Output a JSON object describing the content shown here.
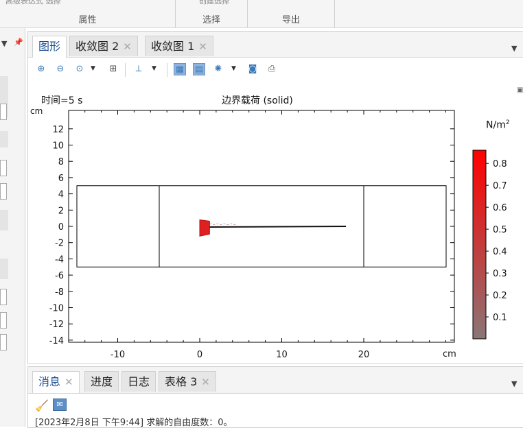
{
  "ribbon": {
    "groups": [
      {
        "label": "属性",
        "top_text": "高级表达式  选择"
      },
      {
        "label": "选择",
        "top_text": "创建选择"
      },
      {
        "label": "导出",
        "top_text": ""
      }
    ]
  },
  "graphics_window": {
    "tabs": [
      {
        "label": "图形",
        "closable": false
      },
      {
        "label": "收敛图 2",
        "closable": true
      },
      {
        "label": "收敛图 1",
        "closable": true
      }
    ],
    "toolbar_icons": [
      "zoom-in-icon",
      "zoom-out-icon",
      "zoom-box-icon",
      "zoom-extents-icon",
      "axes-icon",
      "frame-icon",
      "legend-icon",
      "scene-light-icon",
      "camera-icon",
      "print-icon"
    ]
  },
  "plot": {
    "time_label": "时间=5 s",
    "title": "边界载荷 (solid)",
    "y_unit": "cm",
    "x_unit": "cm",
    "colorbar_unit": "N/m",
    "colorbar_unit_sup": "2"
  },
  "chart_data": {
    "type": "heatmap",
    "title": "边界载荷 (solid)",
    "xlabel": "cm",
    "ylabel": "cm",
    "xlim": [
      -15,
      30
    ],
    "ylim": [
      -14,
      14
    ],
    "x_ticks": [
      -10,
      0,
      10,
      20
    ],
    "x_tick_labels": [
      "-10",
      "0",
      "10",
      "20"
    ],
    "y_ticks": [
      12,
      10,
      8,
      6,
      4,
      2,
      0,
      -2,
      -4,
      -6,
      -8,
      -10,
      -12,
      -14
    ],
    "y_tick_labels": [
      "12",
      "10",
      "8",
      "6",
      "4",
      "2",
      "0",
      "-2",
      "-4",
      "-6",
      "-8",
      "-10",
      "-12",
      "-14"
    ],
    "domain_outer": {
      "x": [
        -15,
        30
      ],
      "y": [
        -5,
        5
      ]
    },
    "domain_dividers_x": [
      -5,
      20
    ],
    "beam": {
      "x_start": 0,
      "x_end": 18,
      "y": 0
    },
    "load_region": {
      "x": [
        0,
        1.2
      ],
      "y": [
        -1.2,
        0.8
      ],
      "color": "#e02020"
    },
    "colorbar": {
      "min": 0,
      "max": 0.86,
      "ticks": [
        0.1,
        0.2,
        0.3,
        0.4,
        0.5,
        0.6,
        0.7,
        0.8
      ],
      "tick_labels": [
        "0.1",
        "0.2",
        "0.3",
        "0.4",
        "0.5",
        "0.6",
        "0.7",
        "0.8"
      ],
      "color_low": "#8a7676",
      "color_high": "#ff0000"
    }
  },
  "message_window": {
    "tabs": [
      {
        "label": "消息",
        "closable": true
      },
      {
        "label": "进度",
        "closable": false
      },
      {
        "label": "日志",
        "closable": false
      },
      {
        "label": "表格 3",
        "closable": true
      }
    ],
    "log_line": "[2023年2月8日 下午9:44] 求解的自由度数：0。"
  },
  "colors": {
    "accent": "#1d4f91",
    "tab_bg": "#e6e6e6"
  }
}
